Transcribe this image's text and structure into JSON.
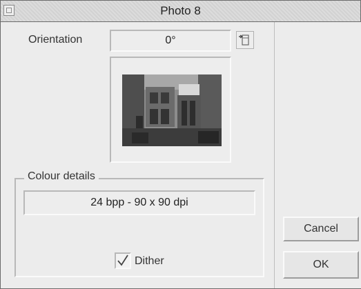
{
  "window": {
    "title": "Photo 8"
  },
  "orientation": {
    "label": "Orientation",
    "value": "0°",
    "rotate_icon": "rotate-icon"
  },
  "preview": {
    "image": "photo-thumbnail"
  },
  "colour_details": {
    "group_title": "Colour details",
    "info": "24 bpp - 90 x 90 dpi",
    "dither": {
      "label": "Dither",
      "checked": true
    }
  },
  "buttons": {
    "cancel": "Cancel",
    "ok": "OK"
  }
}
